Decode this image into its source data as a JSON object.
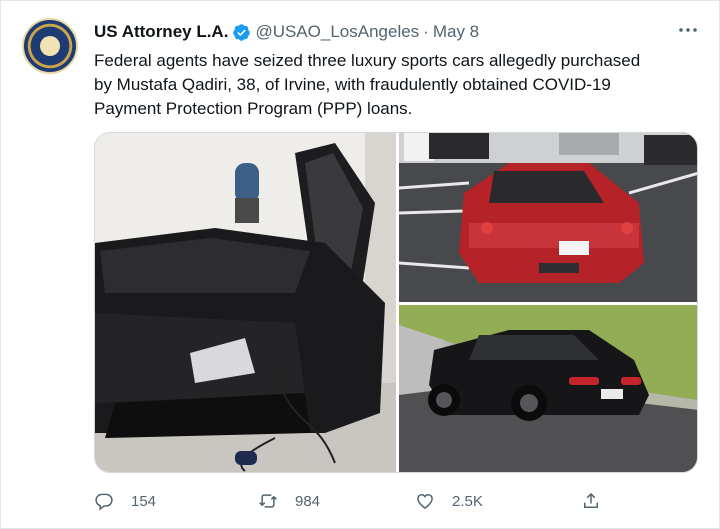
{
  "tweet": {
    "author_name": "US Attorney L.A.",
    "handle": "@USAO_LosAngeles",
    "separator": "·",
    "date": "May 8",
    "text_line1": "Federal agents have seized three luxury sports cars allegedly purchased",
    "text_line2": "by Mustafa Qadiri, 38, of Irvine, with fraudulently obtained COVID-19",
    "text_line3": "Payment Protection Program (PPP) loans."
  },
  "actions": {
    "replies": "154",
    "retweets": "984",
    "likes": "2.5K"
  },
  "colors": {
    "verified": "#1d9bf0",
    "muted": "#536471"
  },
  "icons": [
    "verified-badge-icon",
    "more-icon",
    "reply-icon",
    "retweet-icon",
    "like-icon",
    "share-icon"
  ]
}
